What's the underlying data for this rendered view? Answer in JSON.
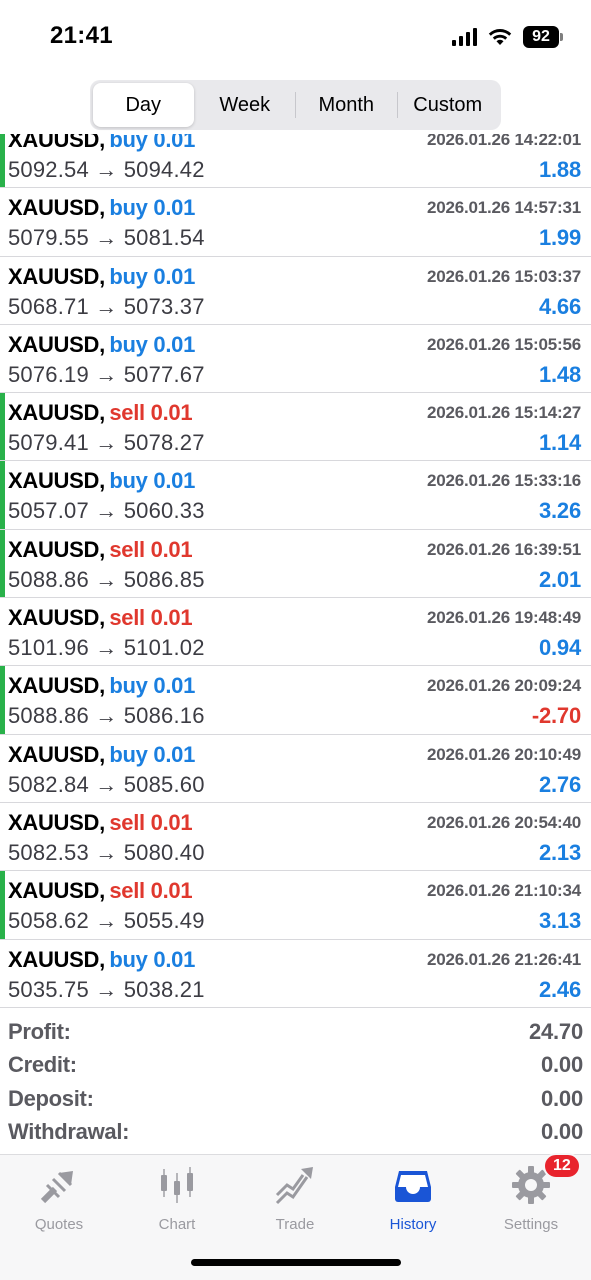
{
  "status": {
    "time": "21:41",
    "battery": "92"
  },
  "segments": [
    {
      "label": "Day",
      "active": true
    },
    {
      "label": "Week",
      "active": false
    },
    {
      "label": "Month",
      "active": false
    },
    {
      "label": "Custom",
      "active": false
    }
  ],
  "trades": [
    {
      "symbol": "XAUUSD,",
      "side": "buy",
      "side_label": "buy 0.01",
      "time": "2026.01.26 14:22:01",
      "prices": "5092.54 → 5094.42",
      "profit": "1.88",
      "marked": true
    },
    {
      "symbol": "XAUUSD,",
      "side": "buy",
      "side_label": "buy 0.01",
      "time": "2026.01.26 14:57:31",
      "prices": "5079.55 → 5081.54",
      "profit": "1.99",
      "marked": false
    },
    {
      "symbol": "XAUUSD,",
      "side": "buy",
      "side_label": "buy 0.01",
      "time": "2026.01.26 15:03:37",
      "prices": "5068.71 → 5073.37",
      "profit": "4.66",
      "marked": false
    },
    {
      "symbol": "XAUUSD,",
      "side": "buy",
      "side_label": "buy 0.01",
      "time": "2026.01.26 15:05:56",
      "prices": "5076.19 → 5077.67",
      "profit": "1.48",
      "marked": false
    },
    {
      "symbol": "XAUUSD,",
      "side": "sell",
      "side_label": "sell 0.01",
      "time": "2026.01.26 15:14:27",
      "prices": "5079.41 → 5078.27",
      "profit": "1.14",
      "marked": true
    },
    {
      "symbol": "XAUUSD,",
      "side": "buy",
      "side_label": "buy 0.01",
      "time": "2026.01.26 15:33:16",
      "prices": "5057.07 → 5060.33",
      "profit": "3.26",
      "marked": true
    },
    {
      "symbol": "XAUUSD,",
      "side": "sell",
      "side_label": "sell 0.01",
      "time": "2026.01.26 16:39:51",
      "prices": "5088.86 → 5086.85",
      "profit": "2.01",
      "marked": true
    },
    {
      "symbol": "XAUUSD,",
      "side": "sell",
      "side_label": "sell 0.01",
      "time": "2026.01.26 19:48:49",
      "prices": "5101.96 → 5101.02",
      "profit": "0.94",
      "marked": false
    },
    {
      "symbol": "XAUUSD,",
      "side": "buy",
      "side_label": "buy 0.01",
      "time": "2026.01.26 20:09:24",
      "prices": "5088.86 → 5086.16",
      "profit": "-2.70",
      "marked": true
    },
    {
      "symbol": "XAUUSD,",
      "side": "buy",
      "side_label": "buy 0.01",
      "time": "2026.01.26 20:10:49",
      "prices": "5082.84 → 5085.60",
      "profit": "2.76",
      "marked": false
    },
    {
      "symbol": "XAUUSD,",
      "side": "sell",
      "side_label": "sell 0.01",
      "time": "2026.01.26 20:54:40",
      "prices": "5082.53 → 5080.40",
      "profit": "2.13",
      "marked": false
    },
    {
      "symbol": "XAUUSD,",
      "side": "sell",
      "side_label": "sell 0.01",
      "time": "2026.01.26 21:10:34",
      "prices": "5058.62 → 5055.49",
      "profit": "3.13",
      "marked": true
    },
    {
      "symbol": "XAUUSD,",
      "side": "buy",
      "side_label": "buy 0.01",
      "time": "2026.01.26 21:26:41",
      "prices": "5035.75 → 5038.21",
      "profit": "2.46",
      "marked": false
    }
  ],
  "summary": [
    {
      "label": "Profit:",
      "value": "24.70"
    },
    {
      "label": "Credit:",
      "value": "0.00"
    },
    {
      "label": "Deposit:",
      "value": "0.00"
    },
    {
      "label": "Withdrawal:",
      "value": "0.00"
    }
  ],
  "tabs": [
    {
      "label": "Quotes",
      "icon": "quotes-icon",
      "active": false
    },
    {
      "label": "Chart",
      "icon": "chart-icon",
      "active": false
    },
    {
      "label": "Trade",
      "icon": "trade-icon",
      "active": false
    },
    {
      "label": "History",
      "icon": "history-icon",
      "active": true
    },
    {
      "label": "Settings",
      "icon": "settings-icon",
      "active": false,
      "badge": "12"
    }
  ],
  "colors": {
    "buy": "#1a7fe0",
    "sell": "#e0382e",
    "marker": "#29b14a",
    "active_tab": "#1a55d6",
    "badge": "#e8232d"
  }
}
